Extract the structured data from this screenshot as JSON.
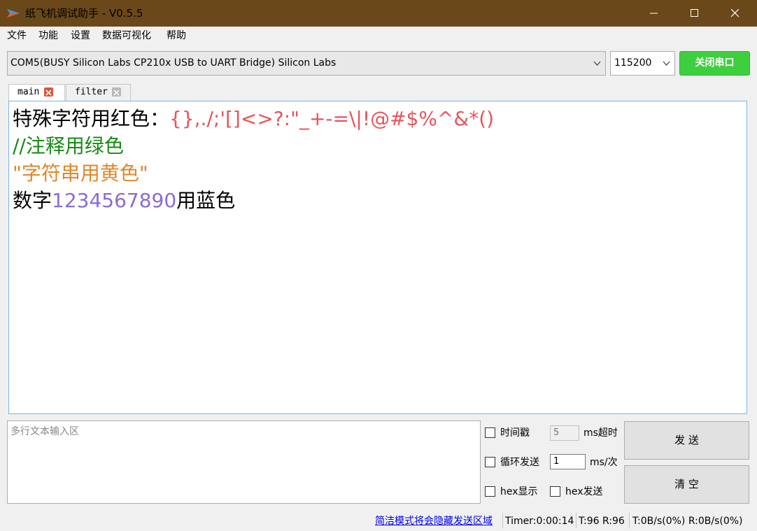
{
  "window": {
    "title": "纸飞机调试助手 - V0.5.5",
    "title_bar_color": "#6b4819",
    "controls": [
      "minimize-icon",
      "maximize-icon",
      "close-icon"
    ]
  },
  "menu": {
    "items": [
      "文件",
      "功能",
      "设置",
      "数据可视化",
      "帮助"
    ]
  },
  "serial": {
    "port_value": "COM5(BUSY  Silicon Labs CP210x USB to UART Bridge) Silicon Labs",
    "baud_value": "115200",
    "toggle_label": "关闭串口",
    "toggle_color": "#3ecf3e"
  },
  "tabs": [
    {
      "label": "main",
      "active": true
    },
    {
      "label": "filter",
      "active": false
    }
  ],
  "output": {
    "line1_prefix": "特殊字符用红色：",
    "line1_special": "{},./;'[]<>?:\"_+-=\\|!@#$%^&*()",
    "line2": "//注释用绿色",
    "line3": "\"字符串用黄色\"",
    "line4_prefix": "数字",
    "line4_number": "1234567890",
    "line4_suffix": "用蓝色",
    "colors": {
      "special": "#e8545a",
      "comment": "#168a16",
      "string": "#e2862a",
      "number": "#8a6bd6",
      "text": "#000000"
    }
  },
  "send": {
    "input_placeholder": "多行文本输入区",
    "timestamp_label": "时间戳",
    "timeout_value": "5",
    "timeout_unit": "ms超时",
    "loop_label": "循环发送",
    "interval_value": "1",
    "interval_unit": "ms/次",
    "hex_display_label": "hex显示",
    "hex_send_label": "hex发送",
    "send_button": "发 送",
    "clear_button": "清 空"
  },
  "status_bar": {
    "simple_mode_link": "简洁模式将会隐藏发送区域",
    "timer": "Timer:0:00:14",
    "counts": "T:96 R:96",
    "rates": "T:0B/s(0%) R:0B/s(0%)"
  }
}
